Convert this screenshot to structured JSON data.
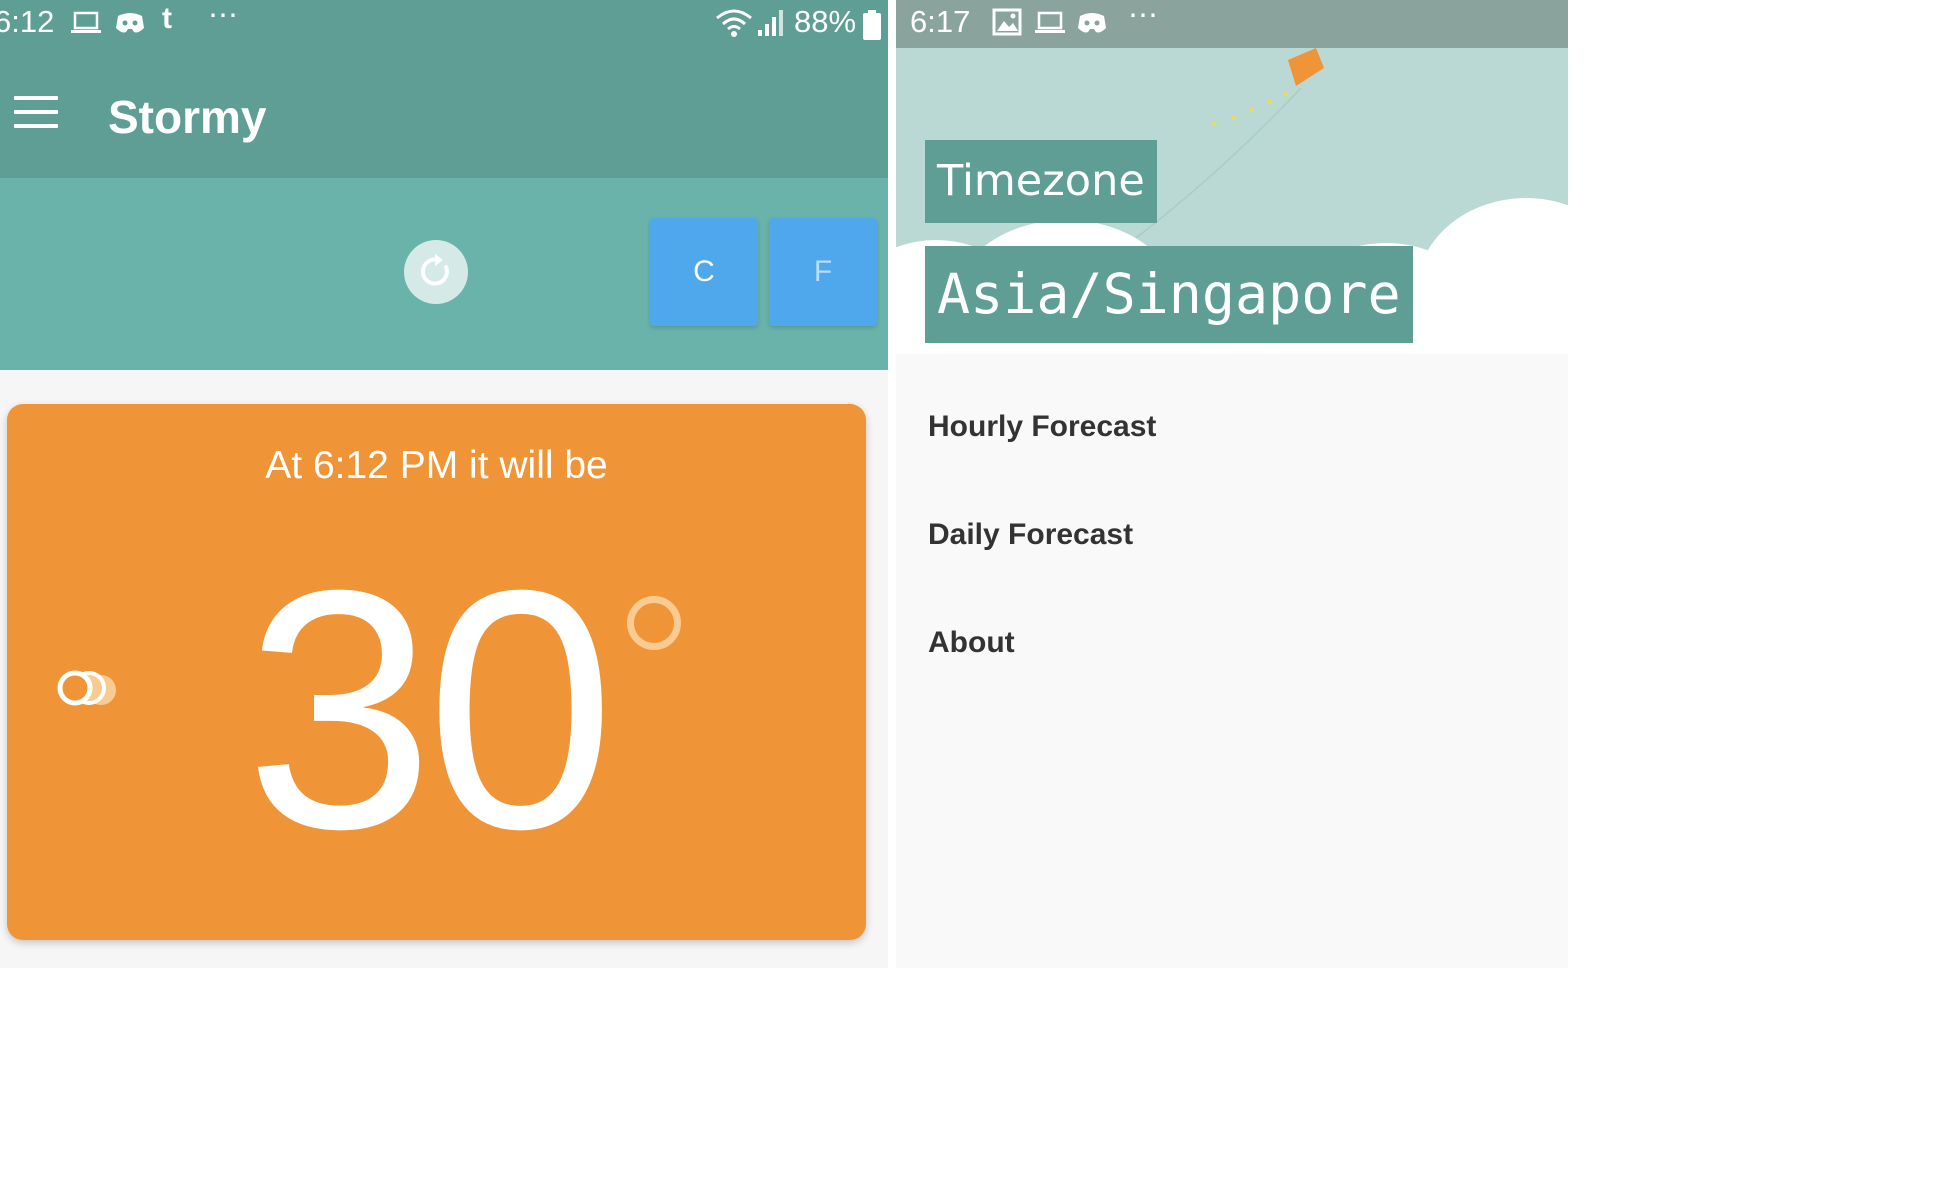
{
  "left_screen": {
    "status_bar": {
      "time": "6:12",
      "overflow": "⋯",
      "tumblr_glyph": "t",
      "battery": "88%"
    },
    "app_bar": {
      "title": "Stormy",
      "menu_icon": "hamburger-menu-icon"
    },
    "controls": {
      "refresh_icon": "refresh-icon",
      "celsius_label": "C",
      "fahrenheit_label": "F"
    },
    "weather_card": {
      "caption": "At 6:12 PM it will be",
      "temperature": "30",
      "condition_icon": "partly-cloudy-icon"
    },
    "colors": {
      "primary": "#5f9e95",
      "controls_bg": "#69b3aa",
      "card": "#ef9437",
      "unit_button": "#4fa8ec"
    }
  },
  "right_screen": {
    "status_bar": {
      "time": "6:17",
      "overflow": "⋯"
    },
    "drawer_header": {
      "timezone_label": "Timezone",
      "timezone_value": "Asia/Singapore"
    },
    "drawer_menu": [
      "Hourly Forecast",
      "Daily Forecast",
      "About"
    ],
    "colors": {
      "header_sky": "#bad9d4",
      "label_bg": "#5f9e95",
      "kite": "#ef9437"
    }
  }
}
